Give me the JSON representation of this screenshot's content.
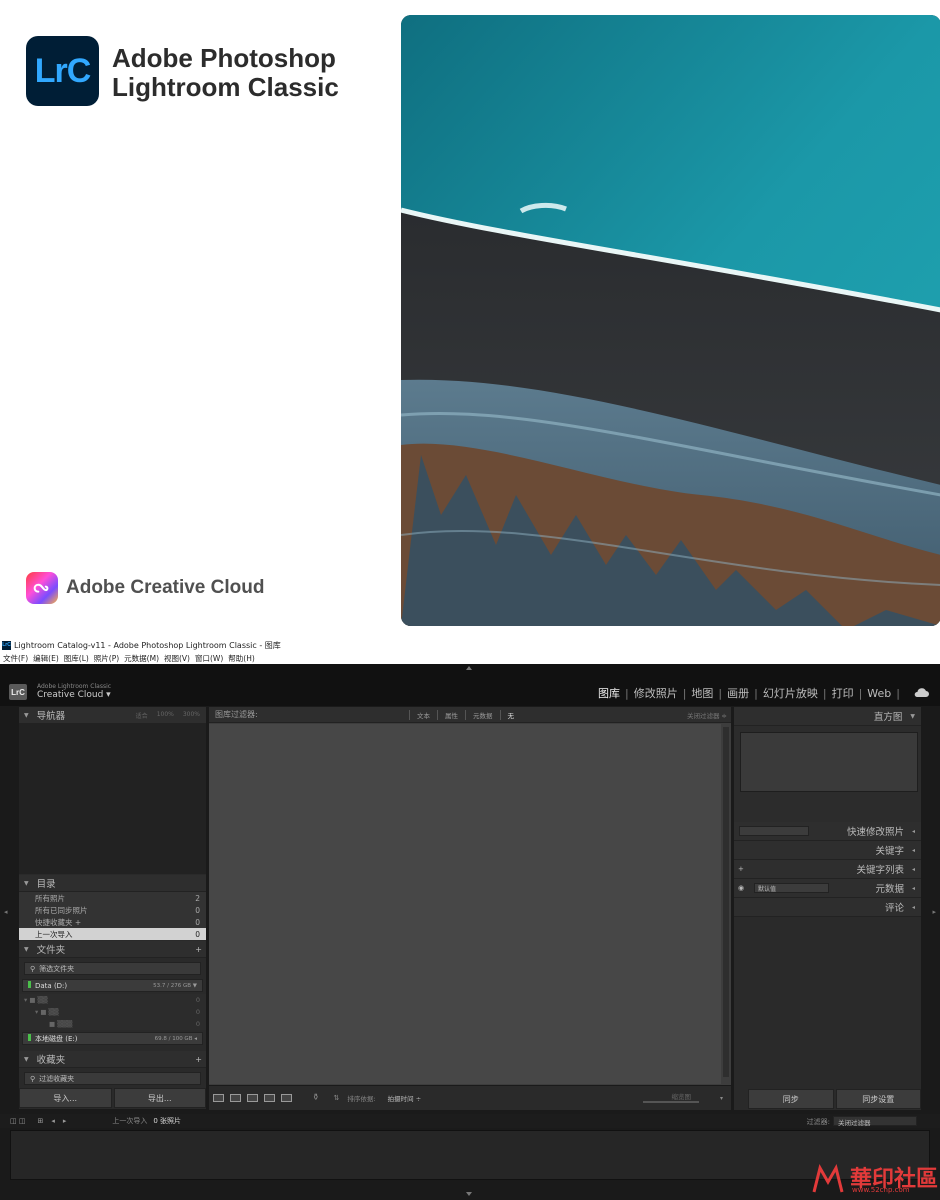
{
  "splash": {
    "app_icon_text": "LrC",
    "product_line1": "Adobe Photoshop",
    "product_line2": "Lightroom Classic",
    "cc_label": "Adobe Creative Cloud"
  },
  "window": {
    "title": "Lightroom Catalog-v11 - Adobe Photoshop Lightroom Classic - 图库",
    "title_icon": "LrC",
    "menu": [
      "文件(F)",
      "编辑(E)",
      "图库(L)",
      "照片(P)",
      "元数据(M)",
      "视图(V)",
      "窗口(W)",
      "帮助(H)"
    ]
  },
  "identity": {
    "badge": "LrC",
    "line1": "Adobe Lightroom Classic",
    "line2": "Creative Cloud"
  },
  "modules": [
    {
      "label": "图库",
      "active": true
    },
    {
      "label": "修改照片",
      "active": false
    },
    {
      "label": "地图",
      "active": false
    },
    {
      "label": "画册",
      "active": false
    },
    {
      "label": "幻灯片放映",
      "active": false
    },
    {
      "label": "打印",
      "active": false
    },
    {
      "label": "Web",
      "active": false
    }
  ],
  "left": {
    "navigator": "导航器",
    "zoom": [
      "适合",
      "100%",
      "300%"
    ],
    "catalog": "目录",
    "catalog_items": [
      {
        "label": "所有照片",
        "count": "2"
      },
      {
        "label": "所有已同步照片",
        "count": "0"
      },
      {
        "label": "快捷收藏夹 +",
        "count": "0"
      },
      {
        "label": "上一次导入",
        "count": "0"
      }
    ],
    "folders": "文件夹",
    "filter_folders": "筛选文件夹",
    "volumes": [
      {
        "label": "Data (D:)",
        "cap": "53.7 / 276 GB"
      },
      {
        "label": "本地磁盘 (E:)",
        "cap": "69.8 / 100 GB"
      }
    ],
    "tree_counts": [
      "0",
      "0",
      "0"
    ],
    "collections": "收藏夹",
    "filter_collections": "过滤收藏夹",
    "import_btn": "导入...",
    "export_btn": "导出..."
  },
  "center": {
    "filter_title": "图库过滤器:",
    "filter_options": [
      {
        "label": "文本",
        "on": false
      },
      {
        "label": "属性",
        "on": false
      },
      {
        "label": "元数据",
        "on": false
      },
      {
        "label": "无",
        "on": true
      }
    ],
    "filter_right": "关闭过滤器 ≑",
    "sort_label": "排序依据:",
    "sort_value": "拍摄时间 ÷",
    "thumb_label": "缩览图"
  },
  "right": {
    "histogram": "直方图",
    "quick_develop": "快速修改照片",
    "keywording": "关键字",
    "keyword_list": "关键字列表",
    "metadata": "元数据",
    "metadata_preset": "默认值",
    "comments": "评论",
    "sync_btn": "同步",
    "sync_settings_btn": "同步设置"
  },
  "filmstrip": {
    "source": "上一次导入",
    "count": "0 张照片",
    "filter_label": "过滤器:",
    "filter_value": "关闭过滤器"
  },
  "watermark": {
    "text": "華印社區",
    "url": "www.52cnp.com"
  }
}
